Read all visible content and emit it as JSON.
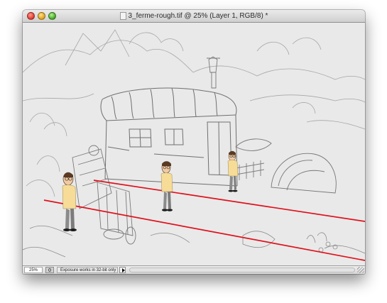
{
  "window": {
    "title": "3_ferme-rough.tif @ 25% (Layer 1, RGB/8) *"
  },
  "statusbar": {
    "zoom": "25%",
    "message": "Exposure works in 32-bit only"
  },
  "canvas": {
    "guide_line_color": "#e0101b",
    "character_count": 3
  }
}
